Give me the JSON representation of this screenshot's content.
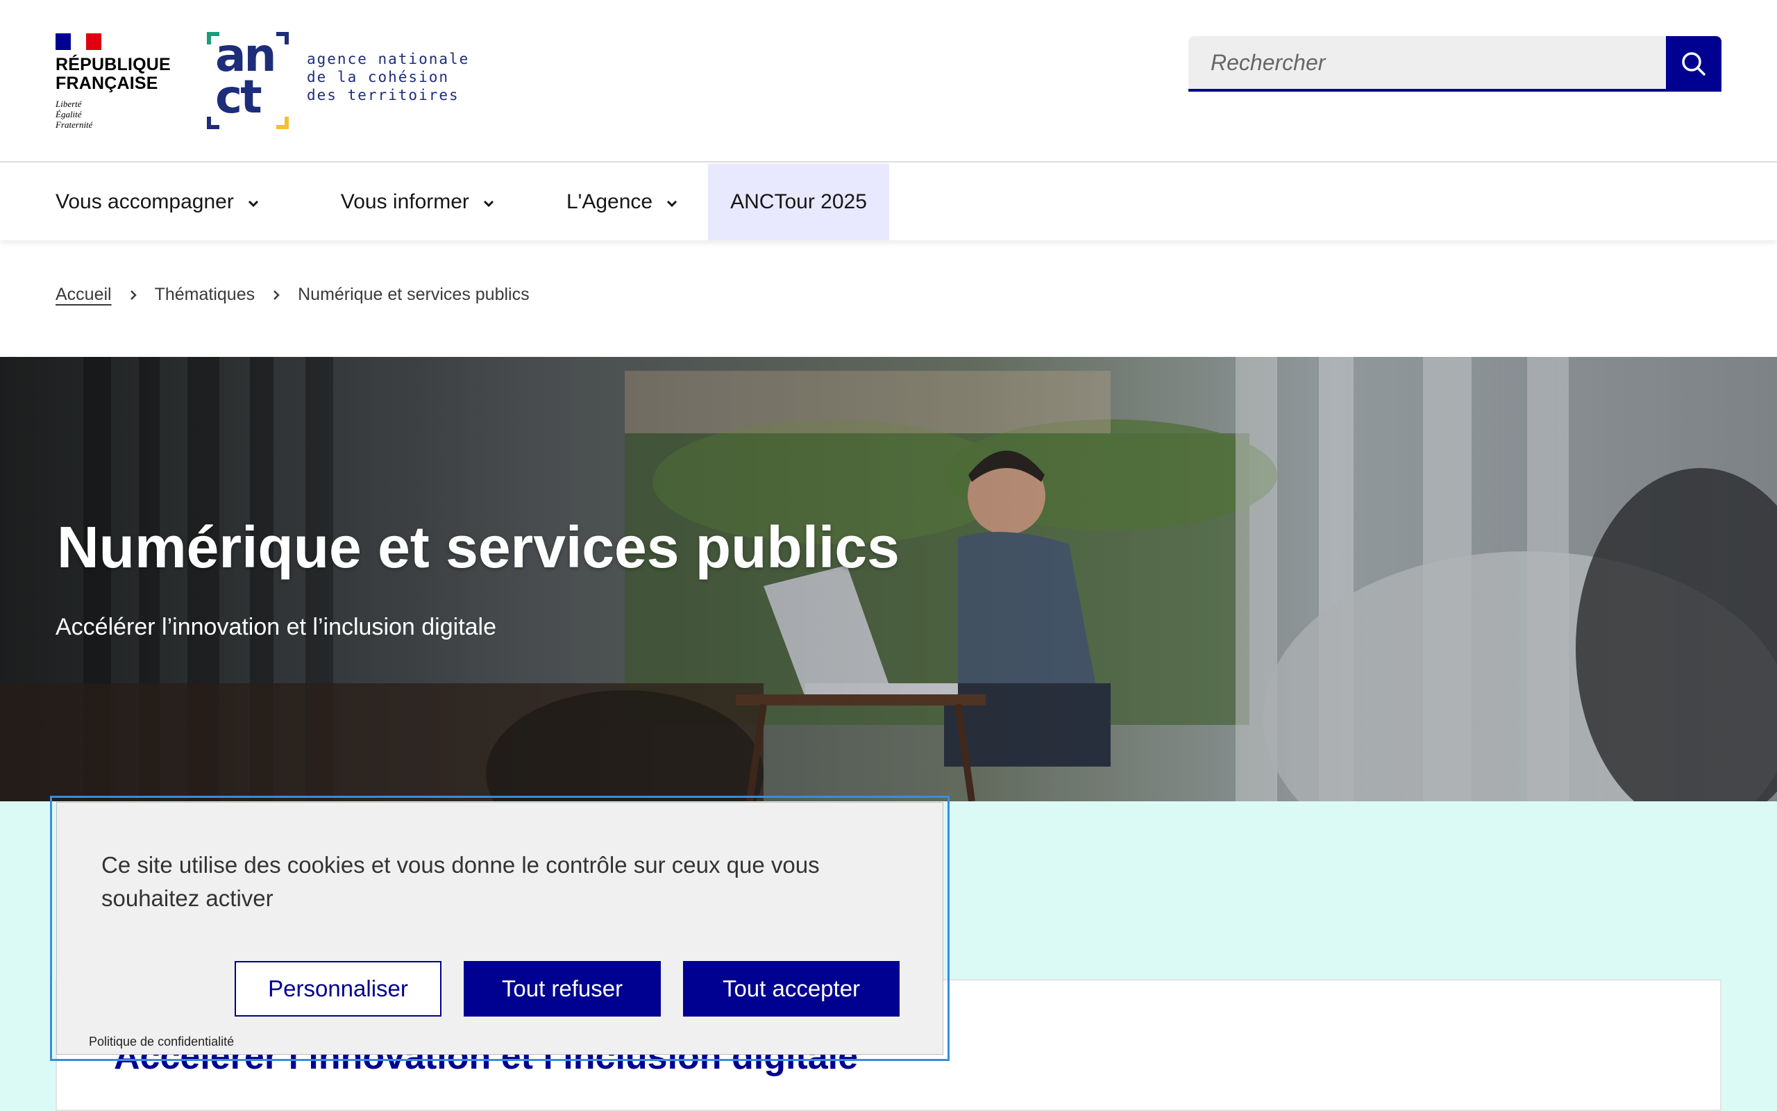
{
  "header": {
    "republique_line1": "RÉPUBLIQUE",
    "republique_line2": "FRANÇAISE",
    "motto": [
      "Liberté",
      "Égalité",
      "Fraternité"
    ],
    "anct_letters_top": "an",
    "anct_letters_bottom": "ct",
    "anct_name": [
      "agence nationale",
      "de la cohésion",
      "des territoires"
    ],
    "search_placeholder": "Rechercher",
    "search_icon": "search-icon"
  },
  "nav": {
    "items": [
      {
        "label": "Vous accompagner",
        "has_dropdown": true
      },
      {
        "label": "Vous informer",
        "has_dropdown": true
      },
      {
        "label": "L'Agence",
        "has_dropdown": true
      },
      {
        "label": "ANCTour 2025",
        "has_dropdown": false
      }
    ]
  },
  "breadcrumb": {
    "items": [
      "Accueil",
      "Thématiques",
      "Numérique et services publics"
    ]
  },
  "hero": {
    "title": "Numérique et services publics",
    "subtitle": "Accélérer l’innovation et l’inclusion digitale"
  },
  "content": {
    "card_title": "Accélérer l’innovation et l’inclusion digitale"
  },
  "cookie": {
    "message": "Ce site utilise des cookies et vous donne le contrôle sur ceux que vous souhaitez activer",
    "personalize": "Personnaliser",
    "refuse": "Tout refuser",
    "accept": "Tout accepter",
    "privacy": "Politique de confidentialité"
  },
  "colors": {
    "primary": "#000091",
    "mint_bg": "#dcfaf5",
    "nav_active_bg": "#e8e8ff"
  }
}
